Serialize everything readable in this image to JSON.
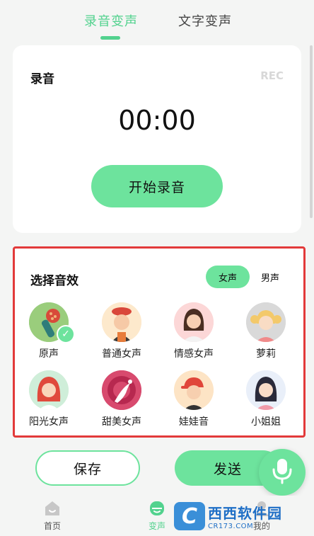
{
  "top_tabs": {
    "record": "录音变声",
    "text": "文字变声"
  },
  "recorder": {
    "title": "录音",
    "rec_label": "REC",
    "timer": "00:00",
    "start_button": "开始录音"
  },
  "effects": {
    "title": "选择音效",
    "gender_female": "女声",
    "gender_male": "男声",
    "voices": [
      {
        "label": "原声",
        "icon": "microphone-avatar",
        "selected": true
      },
      {
        "label": "普通女声",
        "icon": "woman-chef-avatar",
        "selected": false
      },
      {
        "label": "情感女声",
        "icon": "woman-avatar",
        "selected": false
      },
      {
        "label": "萝莉",
        "icon": "girl-blonde-avatar",
        "selected": false
      },
      {
        "label": "阳光女声",
        "icon": "redhead-girl-avatar",
        "selected": false
      },
      {
        "label": "甜美女声",
        "icon": "silhouette-avatar",
        "selected": false
      },
      {
        "label": "娃娃音",
        "icon": "kid-cap-avatar",
        "selected": false
      },
      {
        "label": "小姐姐",
        "icon": "young-woman-avatar",
        "selected": false
      }
    ]
  },
  "actions": {
    "save": "保存",
    "send": "发送"
  },
  "bottom_nav": {
    "home": "首页",
    "voice": "变声",
    "mine": "我的"
  },
  "watermark": {
    "title": "西西软件园",
    "url": "CR173.COM"
  },
  "colors": {
    "accent": "#6de39d",
    "accent_text": "#52d28e",
    "highlight_border": "#e23a3a"
  }
}
